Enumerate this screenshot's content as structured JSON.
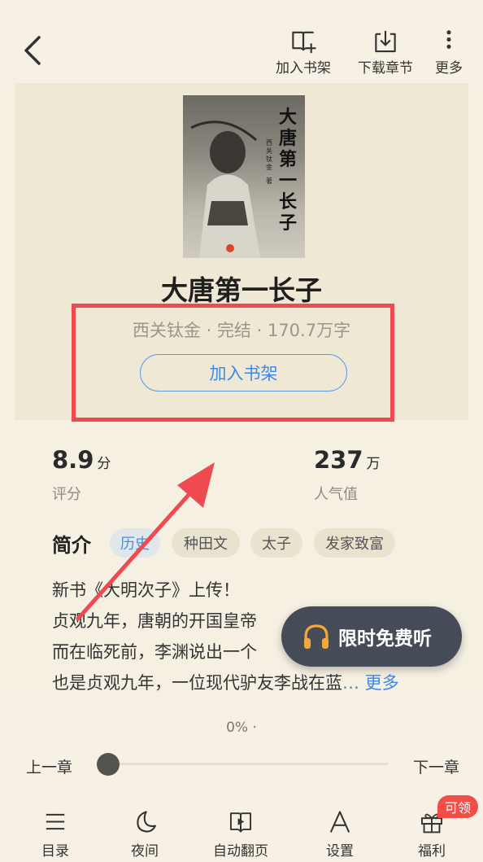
{
  "header": {
    "add_to_shelf": "加入书架",
    "download_chapters": "下载章节",
    "more": "更多"
  },
  "book": {
    "title": "大唐第一长子",
    "meta": "西关钛金 · 完结 · 170.7万字",
    "add_button": "加入书架",
    "cover_title": "大唐第一长子",
    "cover_author": "西关钛金",
    "cover_author_suffix": "著"
  },
  "stats": {
    "rating_value": "8.9",
    "rating_unit": "分",
    "rating_label": "评分",
    "popularity_value": "237",
    "popularity_unit": "万",
    "popularity_label": "人气值"
  },
  "intro": {
    "heading": "简介",
    "tags": [
      "历史",
      "种田文",
      "太子",
      "发家致富"
    ],
    "lines": [
      "新书《大明次子》上传！",
      "贞观九年，唐朝的开国皇帝",
      "而在临死前，李渊说出一个",
      "也是贞观九年，一位现代驴友李战在蓝"
    ],
    "more": "… 更多"
  },
  "listen": {
    "label": "限时免费听"
  },
  "reader": {
    "progress": "0% ·",
    "progress_value": 0,
    "prev_chapter": "上一章",
    "next_chapter": "下一章"
  },
  "bottom_nav": {
    "toc": "目录",
    "night": "夜间",
    "auto_page": "自动翻页",
    "settings": "设置",
    "welfare": "福利",
    "claim_badge": "可领"
  }
}
